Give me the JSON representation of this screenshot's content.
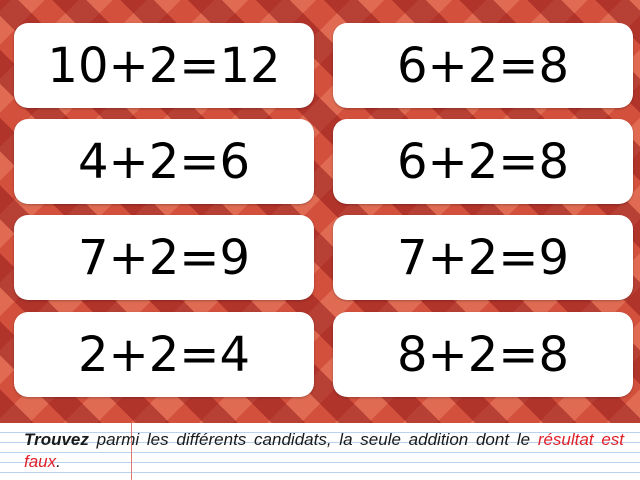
{
  "cards": [
    {
      "equation": "10+2=12"
    },
    {
      "equation": "6+2=8"
    },
    {
      "equation": "4+2=6"
    },
    {
      "equation": "6+2=8"
    },
    {
      "equation": "7+2=9"
    },
    {
      "equation": "7+2=9"
    },
    {
      "equation": "2+2=4"
    },
    {
      "equation": "8+2=8"
    }
  ],
  "instruction": {
    "bold_word": "Trouvez",
    "text_line": " parmi les différents candidats, la seule addition dont le ",
    "highlight": "résultat est faux",
    "end": "."
  },
  "colors": {
    "board": "#d2503c",
    "card": "#ffffff",
    "highlight": "#e0202a"
  }
}
